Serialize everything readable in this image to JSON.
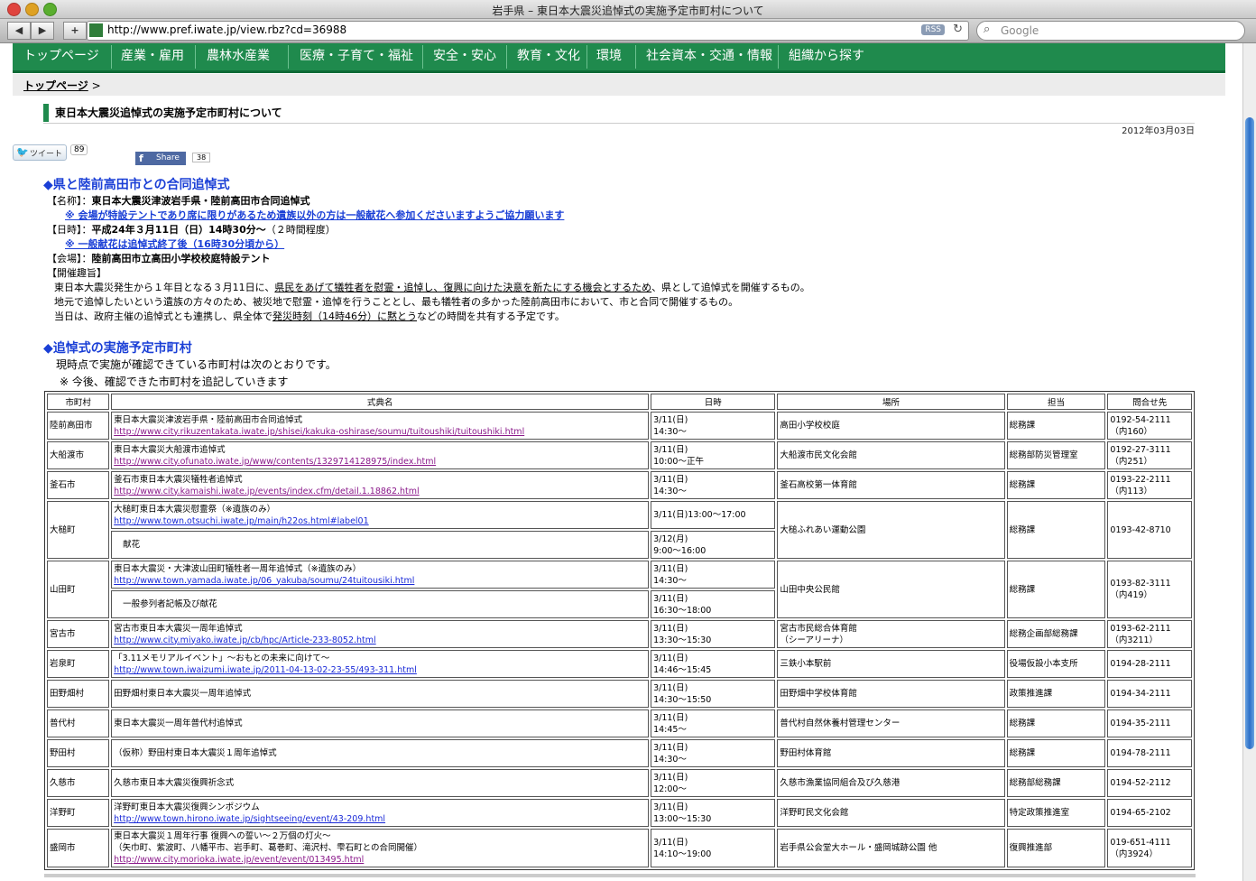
{
  "window": {
    "title": "岩手県 – 東日本大震災追悼式の実施予定市町村について"
  },
  "toolbar": {
    "back": "◀",
    "forward": "▶",
    "add": "+",
    "url": "http://www.pref.iwate.jp/view.rbz?cd=36988",
    "rss": "RSS",
    "reload": "↻",
    "search_placeholder": "Google"
  },
  "nav": {
    "items": [
      "トップページ",
      "産業・雇用",
      "農林水産業",
      "医療・子育て・福祉",
      "安全・安心",
      "教育・文化",
      "環境",
      "社会資本・交通・情報",
      "組織から探す"
    ]
  },
  "breadcrumb": {
    "top": "トップページ",
    "sep": " >"
  },
  "page": {
    "heading": "東日本大震災追悼式の実施予定市町村について",
    "date": "2012年03月03日"
  },
  "social": {
    "tweet_label": "ツイート",
    "tweet_count": "89",
    "share_label": "Share",
    "share_count": "38"
  },
  "section1": {
    "title": "◆県と陸前高田市との合同追悼式",
    "name_label": "【名称】：",
    "name_value": "東日本大震災津波岩手県・陸前高田市合同追悼式",
    "note1": "※ 会場が特設テントであり席に限りがあるため遺族以外の方は一般献花へ参加くださいますようご協力願います",
    "date_label": "【日時】：",
    "date_value": "平成24年３月11日（日）14時30分～",
    "date_extra": "（２時間程度）",
    "note2": "※ 一般献花は追悼式終了後（16時30分頃から）",
    "venue_label": "【会場】：",
    "venue_value": "陸前高田市立高田小学校校庭特設テント",
    "purpose_label": "【開催趣旨】",
    "p1_a": "東日本大震災発生から１年目となる３月11日に、",
    "p1_b": "県民をあげて犠牲者を慰霊・追悼し、復興に向けた決意を新たにする機会とするため",
    "p1_c": "、県として追悼式を開催するもの。",
    "p2": "地元で追悼したいという遺族の方々のため、被災地で慰霊・追悼を行うこととし、最も犠牲者の多かった陸前高田市において、市と合同で開催するもの。",
    "p3_a": "当日は、政府主催の追悼式とも連携し、県全体で",
    "p3_b": "発災時刻（14時46分）に黙とう",
    "p3_c": "などの時間を共有する予定です。"
  },
  "section2": {
    "title": "◆追悼式の実施予定市町村",
    "intro": "現時点で実施が確認できている市町村は次のとおりです。",
    "note": "※ 今後、確認できた市町村を追記していきます"
  },
  "table": {
    "headers": [
      "市町村",
      "式典名",
      "日時",
      "場所",
      "担当",
      "問合せ先"
    ],
    "rows": {
      "r1": {
        "city": "陸前高田市",
        "name": "東日本大震災津波岩手県・陸前高田市合同追悼式",
        "url": "http://www.city.rikuzentakata.iwate.jp/shisei/kakuka-oshirase/soumu/tuitoushiki/tuitoushiki.html",
        "d1": "3/11(日)",
        "d2": "14:30～",
        "place": "高田小学校校庭",
        "dept": "総務課",
        "tel": "0192-54-2111",
        "ext": "（内160）"
      },
      "r2": {
        "city": "大船渡市",
        "name": "東日本大震災大船渡市追悼式",
        "url": "http://www.city.ofunato.iwate.jp/www/contents/1329714128975/index.html",
        "d1": "3/11(日)",
        "d2": "10:00～正午",
        "place": "大船渡市民文化会館",
        "dept": "総務部防災管理室",
        "tel": "0192-27-3111",
        "ext": "（内251）"
      },
      "r3": {
        "city": "釜石市",
        "name": "釜石市東日本大震災犠牲者追悼式",
        "url": "http://www.city.kamaishi.iwate.jp/events/index.cfm/detail.1.18862.html",
        "d1": "3/11(日)",
        "d2": "14:30～",
        "place": "釜石高校第一体育館",
        "dept": "総務課",
        "tel": "0193-22-2111",
        "ext": "（内113）"
      },
      "r4": {
        "city": "大槌町",
        "name": "大槌町東日本大震災慰霊祭（※遺族のみ）",
        "url": "http://www.town.otsuchi.iwate.jp/main/h22os.html#label01",
        "d1": "3/11(日)13:00～17:00",
        "name2": "献花",
        "d3": "3/12(月)",
        "d4": "9:00～16:00",
        "place": "大槌ふれあい運動公園",
        "dept": "総務課",
        "tel": "0193-42-8710"
      },
      "r5": {
        "city": "山田町",
        "name": "東日本大震災・大津波山田町犠牲者一周年追悼式（※遺族のみ）",
        "url": "http://www.town.yamada.iwate.jp/06_yakuba/soumu/24tuitousiki.html",
        "d1": "3/11(日)",
        "d2": "14:30～",
        "name2": "一般参列者記帳及び献花",
        "d3": "3/11(日)",
        "d4": "16:30～18:00",
        "place": "山田中央公民館",
        "dept": "総務課",
        "tel": "0193-82-3111",
        "ext": "（内419）"
      },
      "r6": {
        "city": "宮古市",
        "name": "宮古市東日本大震災一周年追悼式",
        "url": "http://www.city.miyako.iwate.jp/cb/hpc/Article-233-8052.html",
        "d1": "3/11(日)",
        "d2": "13:30～15:30",
        "place": "宮古市民総合体育館",
        "place2": "（シーアリーナ）",
        "dept": "総務企画部総務課",
        "tel": "0193-62-2111",
        "ext": "（内3211）"
      },
      "r7": {
        "city": "岩泉町",
        "name": "「3.11メモリアルイベント」～おもとの未来に向けて～",
        "url": "http://www.town.iwaizumi.iwate.jp/2011-04-13-02-23-55/493-311.html",
        "d1": "3/11(日)",
        "d2": "14:46～15:45",
        "place": "三鉄小本駅前",
        "dept": "役場仮設小本支所",
        "tel": "0194-28-2111"
      },
      "r8": {
        "city": "田野畑村",
        "name": "田野畑村東日本大震災一周年追悼式",
        "d1": "3/11(日)",
        "d2": "14:30～15:50",
        "place": "田野畑中学校体育館",
        "dept": "政策推進課",
        "tel": "0194-34-2111"
      },
      "r9": {
        "city": "普代村",
        "name": "東日本大震災一周年普代村追悼式",
        "d1": "3/11(日)",
        "d2": "14:45～",
        "place": "普代村自然休養村管理センター",
        "dept": "総務課",
        "tel": "0194-35-2111"
      },
      "r10": {
        "city": "野田村",
        "name": "（仮称）野田村東日本大震災１周年追悼式",
        "d1": "3/11(日)",
        "d2": "14:30～",
        "place": "野田村体育館",
        "dept": "総務課",
        "tel": "0194-78-2111"
      },
      "r11": {
        "city": "久慈市",
        "name": "久慈市東日本大震災復興祈念式",
        "d1": "3/11(日)",
        "d2": "12:00～",
        "place": "久慈市漁業協同組合及び久慈港",
        "dept": "総務部総務課",
        "tel": "0194-52-2112"
      },
      "r12": {
        "city": "洋野町",
        "name": "洋野町東日本大震災復興シンポジウム",
        "url": "http://www.town.hirono.iwate.jp/sightseeing/event/43-209.html",
        "d1": "3/11(日)",
        "d2": "13:00～15:30",
        "place": "洋野町民文化会館",
        "dept": "特定政策推進室",
        "tel": "0194-65-2102"
      },
      "r13": {
        "city": "盛岡市",
        "name": "東日本大震災１周年行事 復興への誓い～２万個の灯火～",
        "name_b": "（矢巾町、紫波町、八幡平市、岩手町、葛巻町、滝沢村、雫石町との合同開催）",
        "url": "http://www.city.morioka.iwate.jp/event/event/013495.html",
        "d1": "3/11(日)",
        "d2": "14:10～19:00",
        "place": "岩手県公会堂大ホール・盛岡城跡公園 他",
        "dept": "復興推進部",
        "tel": "019-651-4111",
        "ext": "（内3924）"
      }
    }
  },
  "colors": {
    "nav_green": "#1f8a4d",
    "link_blue": "#1a3fd6",
    "visited_purple": "#8b1a8b"
  },
  "icons": [
    "back-arrow-icon",
    "forward-arrow-icon",
    "plus-icon",
    "site-favicon-icon",
    "rss-icon",
    "reload-icon",
    "search-icon",
    "twitter-bird-icon",
    "facebook-icon"
  ]
}
